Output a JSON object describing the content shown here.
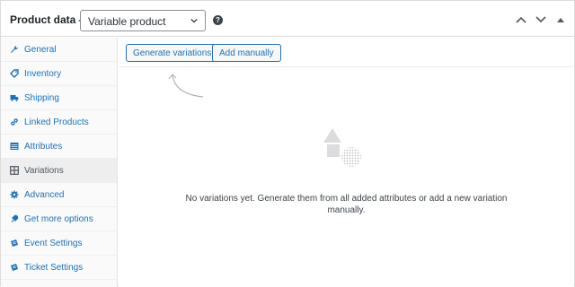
{
  "header": {
    "title": "Product data —",
    "product_type": "Variable product",
    "help_icon": "question-icon",
    "collapse_up_icon": "chevron-up-icon",
    "collapse_down_icon": "chevron-down-icon",
    "toggle_icon": "triangle-up-icon"
  },
  "sidebar": {
    "items": [
      {
        "label": "General",
        "icon": "wrench-icon"
      },
      {
        "label": "Inventory",
        "icon": "tag-icon"
      },
      {
        "label": "Shipping",
        "icon": "truck-icon"
      },
      {
        "label": "Linked Products",
        "icon": "link-icon"
      },
      {
        "label": "Attributes",
        "icon": "table-icon"
      },
      {
        "label": "Variations",
        "icon": "grid-icon",
        "active": true
      },
      {
        "label": "Advanced",
        "icon": "gear-icon"
      },
      {
        "label": "Get more options",
        "icon": "plugin-icon"
      },
      {
        "label": "Event Settings",
        "icon": "ticket-icon"
      },
      {
        "label": "Ticket Settings",
        "icon": "ticket-icon"
      }
    ]
  },
  "main": {
    "generate_label": "Generate variations",
    "add_manually_label": "Add manually",
    "empty_message": "No variations yet. Generate them from all added attributes or add a new variation manually.",
    "empty_icon": "shapes-icon",
    "hint_icon": "curved-arrow-icon"
  },
  "colors": {
    "link": "#2271b1",
    "border": "#dcdcde",
    "active_bg": "#eeeeee",
    "text": "#1d2327"
  }
}
